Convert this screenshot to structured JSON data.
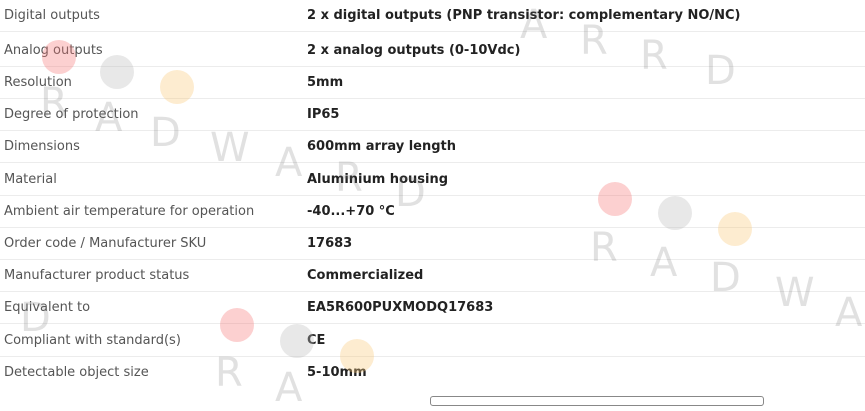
{
  "specs": [
    {
      "label": "Digital outputs",
      "value": "2 x digital outputs (PNP transistor: complementary NO/NC)"
    },
    {
      "label": "Analog outputs",
      "value": "2 x analog outputs (0-10Vdc)"
    },
    {
      "label": "Resolution",
      "value": "5mm"
    },
    {
      "label": "Degree of protection",
      "value": "IP65"
    },
    {
      "label": "Dimensions",
      "value": "600mm array length"
    },
    {
      "label": "Material",
      "value": "Aluminium housing"
    },
    {
      "label": "Ambient air temperature for operation",
      "value": "-40...+70 °C"
    },
    {
      "label": "Order code / Manufacturer SKU",
      "value": "17683"
    },
    {
      "label": "Manufacturer product status",
      "value": "Commercialized"
    },
    {
      "label": "Equivalent to",
      "value": "EA5R600PUXMODQ17683"
    },
    {
      "label": "Compliant with standard(s)",
      "value": "CE"
    },
    {
      "label": "Detectable object size",
      "value": "5-10mm"
    }
  ],
  "watermark": {
    "letters": [
      "R",
      "A",
      "D",
      "W",
      "A",
      "R",
      "D"
    ]
  },
  "colors": {
    "label": "#555555",
    "value": "#222222",
    "divider": "#ececec"
  }
}
